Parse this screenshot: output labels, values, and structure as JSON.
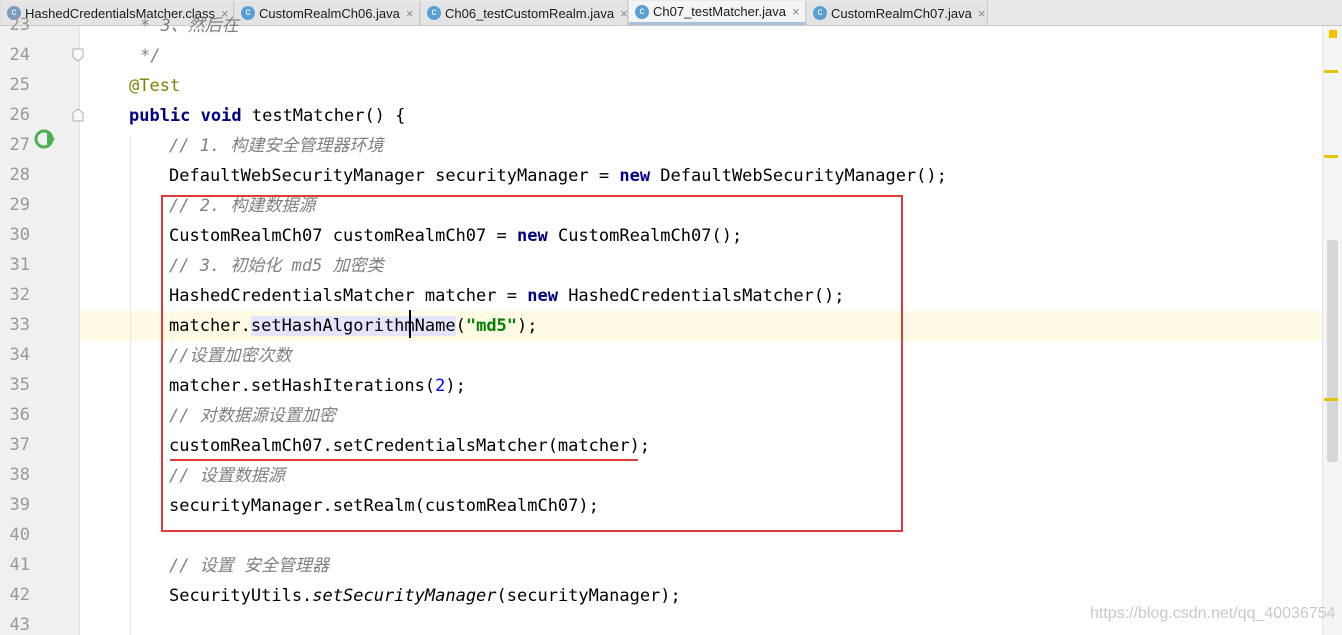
{
  "tabs": [
    {
      "label": "HashedCredentialsMatcher.class",
      "icon": "class-file-icon",
      "active": false
    },
    {
      "label": "CustomRealmCh06.java",
      "icon": "java-class-icon",
      "active": false
    },
    {
      "label": "Ch06_testCustomRealm.java",
      "icon": "java-class-icon",
      "active": false
    },
    {
      "label": "Ch07_testMatcher.java",
      "icon": "java-class-icon",
      "active": true
    },
    {
      "label": "CustomRealmCh07.java",
      "icon": "java-class-icon",
      "active": false
    }
  ],
  "close_glyph": "×",
  "line_numbers": [
    "23",
    "24",
    "25",
    "26",
    "27",
    "28",
    "29",
    "30",
    "31",
    "32",
    "33",
    "34",
    "35",
    "36",
    "37",
    "38",
    "39",
    "40",
    "41",
    "42",
    "43"
  ],
  "code": {
    "l23": {
      "text": "* 3、然后在"
    },
    "l24": {
      "text": "*/"
    },
    "l25": {
      "annotation": "@Test"
    },
    "l26": {
      "kw1": "public",
      "kw2": "void",
      "rest": " testMatcher() {"
    },
    "l27": {
      "comment": "// 1. 构建安全管理器环境"
    },
    "l28": {
      "a": "DefaultWebSecurityManager securityManager = ",
      "kw": "new",
      "b": " DefaultWebSecurityManager();"
    },
    "l29": {
      "comment": "// 2. 构建数据源"
    },
    "l30": {
      "a": "CustomRealmCh07 customRealmCh07 = ",
      "kw": "new",
      "b": " CustomRealmCh07();"
    },
    "l31": {
      "comment": "// 3. 初始化 md5 加密类"
    },
    "l32": {
      "a": "HashedCredentialsMatcher matcher = ",
      "kw": "new",
      "b": " HashedCredentialsMatcher();"
    },
    "l33": {
      "a": "matcher.",
      "method": "setHashAlgorithmName",
      "b": "(",
      "str": "\"md5\"",
      "c": ");"
    },
    "l34": {
      "comment": "//设置加密次数"
    },
    "l35": {
      "a": "matcher.setHashIterations(",
      "num": "2",
      "b": ");"
    },
    "l36": {
      "comment": "// 对数据源设置加密"
    },
    "l37": {
      "text": "customRealmCh07.setCredentialsMatcher(matcher);"
    },
    "l38": {
      "comment": "// 设置数据源"
    },
    "l39": {
      "text": "securityManager.setRealm(customRealmCh07);"
    },
    "l40": {
      "text": ""
    },
    "l41": {
      "comment": "// 设置 安全管理器"
    },
    "l42": {
      "a": "SecurityUtils.",
      "italic": "setSecurityManager",
      "b": "(securityManager);"
    },
    "l43": {
      "text": ""
    }
  },
  "watermark": "https://blog.csdn.net/qq_40036754",
  "colors": {
    "highlight_box": "#e23a3a",
    "keyword": "#000080",
    "comment": "#808080",
    "string": "#008000",
    "number": "#0000ff",
    "annotation": "#808000"
  }
}
